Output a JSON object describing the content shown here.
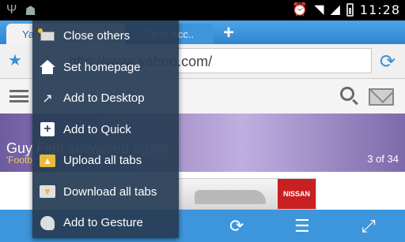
{
  "status_bar": {
    "time": "11:28"
  },
  "tabs": {
    "active_label": "Ya",
    "inactive_label": "...Other Acc..",
    "new_tab": "+"
  },
  "url_bar": {
    "url": "http://www.yahoo.com/"
  },
  "hero": {
    "title": "Guy Fieri skewered again",
    "category": "'Footb",
    "counter": "3 of 34"
  },
  "ad": {
    "brand": "NISSAN"
  },
  "context_menu": {
    "items": [
      {
        "label": "Close others",
        "icon": "close-others-icon"
      },
      {
        "label": "Set homepage",
        "icon": "home-icon"
      },
      {
        "label": "Add to Desktop",
        "icon": "shortcut-arrow-icon"
      },
      {
        "label": "Add to Quick",
        "icon": "plus-icon"
      },
      {
        "label": "Upload all tabs",
        "icon": "upload-icon"
      },
      {
        "label": "Download all tabs",
        "icon": "download-icon"
      },
      {
        "label": "Add to Gesture",
        "icon": "gesture-icon"
      }
    ]
  },
  "colors": {
    "accent": "#3d95dc",
    "menu_bg": "#283e56",
    "hero_bg": "#a691c8"
  }
}
